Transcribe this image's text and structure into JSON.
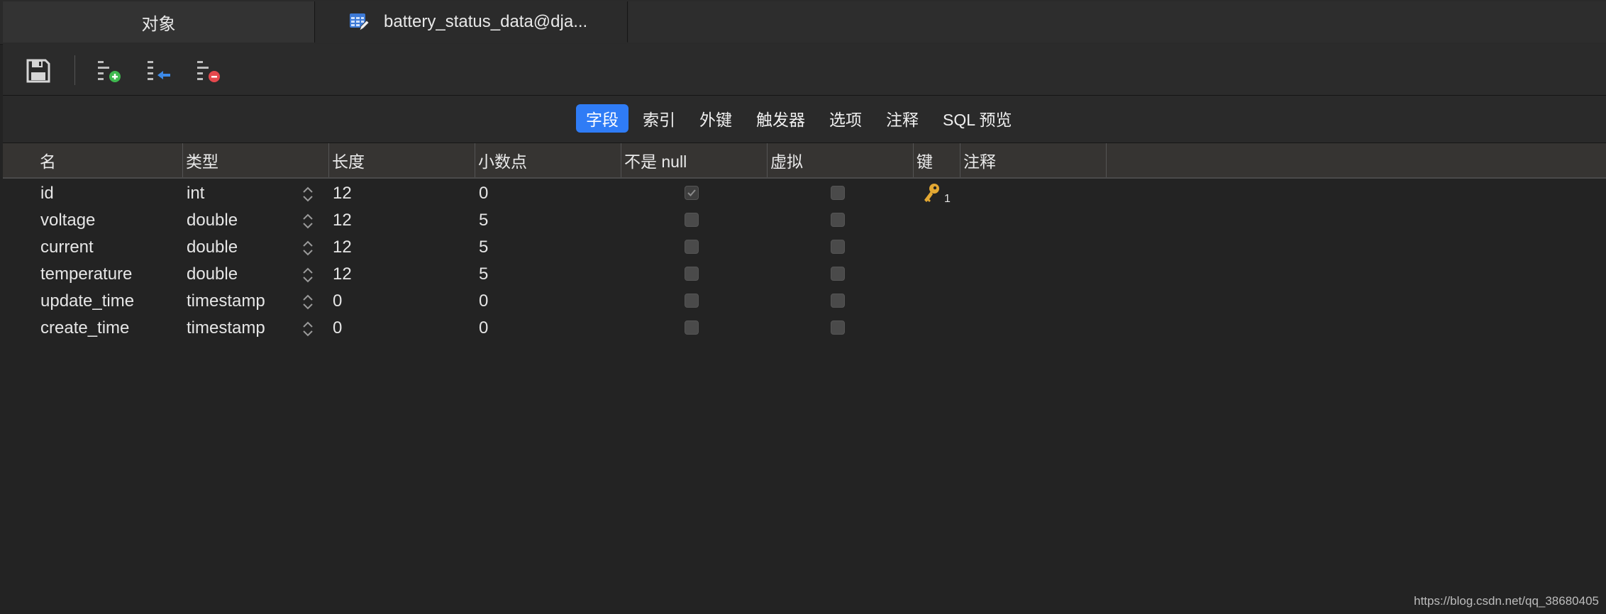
{
  "tabs": {
    "objects_label": "对象",
    "table_label": "battery_status_data@dja..."
  },
  "toolbar": {
    "save_icon": "save-icon",
    "add_field_icon": "add-field-icon",
    "insert_field_icon": "insert-field-icon",
    "delete_field_icon": "delete-field-icon"
  },
  "segments": [
    {
      "label": "字段",
      "active": true
    },
    {
      "label": "索引",
      "active": false
    },
    {
      "label": "外键",
      "active": false
    },
    {
      "label": "触发器",
      "active": false
    },
    {
      "label": "选项",
      "active": false
    },
    {
      "label": "注释",
      "active": false
    },
    {
      "label": "SQL 预览",
      "active": false
    }
  ],
  "columns": {
    "name": "名",
    "type": "类型",
    "length": "长度",
    "decimal": "小数点",
    "not_null": "不是 null",
    "virtual": "虚拟",
    "key": "键",
    "comment": "注释"
  },
  "rows": [
    {
      "name": "id",
      "type": "int",
      "length": "12",
      "decimal": "0",
      "not_null": true,
      "virtual": false,
      "key": "1"
    },
    {
      "name": "voltage",
      "type": "double",
      "length": "12",
      "decimal": "5",
      "not_null": false,
      "virtual": false,
      "key": ""
    },
    {
      "name": "current",
      "type": "double",
      "length": "12",
      "decimal": "5",
      "not_null": false,
      "virtual": false,
      "key": ""
    },
    {
      "name": "temperature",
      "type": "double",
      "length": "12",
      "decimal": "5",
      "not_null": false,
      "virtual": false,
      "key": ""
    },
    {
      "name": "update_time",
      "type": "timestamp",
      "length": "0",
      "decimal": "0",
      "not_null": false,
      "virtual": false,
      "key": ""
    },
    {
      "name": "create_time",
      "type": "timestamp",
      "length": "0",
      "decimal": "0",
      "not_null": false,
      "virtual": false,
      "key": ""
    }
  ],
  "footer": {
    "url": "https://blog.csdn.net/qq_38680405"
  },
  "colors": {
    "accent": "#2f7cf6",
    "key": "#e3a833",
    "add": "#3fb950",
    "insert": "#3d8ae8",
    "delete": "#e5484d"
  }
}
